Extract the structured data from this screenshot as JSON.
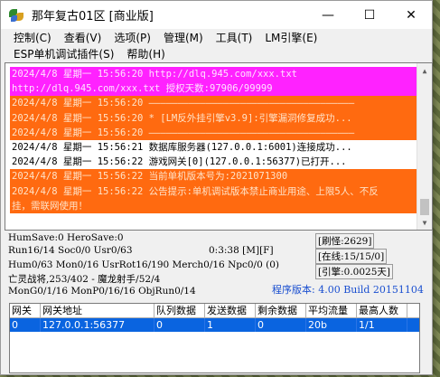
{
  "window": {
    "title": "那年复古01区 [商业版]",
    "minimize": "—",
    "maximize": "☐",
    "close": "✕"
  },
  "menu": {
    "row1": [
      "控制(C)",
      "查看(V)",
      "选项(P)",
      "管理(M)",
      "工具(T)",
      "LM引擎(E)"
    ],
    "row2": [
      "ESP单机调试插件(S)",
      "帮助(H)"
    ]
  },
  "log": [
    {
      "text": "2024/4/8 星期一 15:56:20 http://dlq.945.com/xxx.txt",
      "style": "magenta"
    },
    {
      "text": "http://dlq.945.com/xxx.txt 授权天数:97906/99999",
      "style": "magenta"
    },
    {
      "text": "2024/4/8 星期一 15:56:20 ————————————————————————————————————",
      "style": "orange"
    },
    {
      "text": "2024/4/8 星期一 15:56:20 * [LM反外挂引擎v3.9]:引擎漏洞修复成功...",
      "style": "orange"
    },
    {
      "text": "2024/4/8 星期一 15:56:20 ————————————————————————————————————",
      "style": "orange"
    },
    {
      "text": "2024/4/8 星期一 15:56:21 数据库服务器(127.0.0.1:6001)连接成功...",
      "style": "plain"
    },
    {
      "text": "2024/4/8 星期一 15:56:22 游戏网关[0](127.0.0.1:56377)已打开...",
      "style": "plain"
    },
    {
      "text": "2024/4/8 星期一 15:56:22 当前单机版本号为:2021071300",
      "style": "orange"
    },
    {
      "text": "2024/4/8 星期一 15:56:22 公告提示:单机调试版本禁止商业用途、上限5人、不反",
      "style": "orange"
    },
    {
      "text": "挂，需联网使用！",
      "style": "orange"
    }
  ],
  "status": {
    "humsave": "HumSave:0 HeroSave:0",
    "run": "Run16/14 Soc0/0 Usr0/63",
    "time": "0:3:38 [M][F]",
    "hum": "Hum0/63 Mon0/16 UsrRot16/190 Merch0/16 Npc0/0 (0)",
    "death": "亡灵战将,253/402 - 魔龙射手/52/4",
    "mong": "MonG0/1/16 MonP0/16/16 ObjRun0/14",
    "refresh": "[刷怪:2629]",
    "online": "[在线:15/15/0]",
    "engine": "[引擎:0.0025天]",
    "version": "程序版本: 4.00 Build 20151104"
  },
  "table": {
    "headers": [
      "网关",
      "网关地址",
      "队列数据",
      "发送数据",
      "剩余数据",
      "平均流量",
      "最高人数"
    ],
    "rows": [
      [
        "0",
        "127.0.0.1:56377",
        "0",
        "1",
        "0",
        "20b",
        "1/1"
      ]
    ]
  }
}
